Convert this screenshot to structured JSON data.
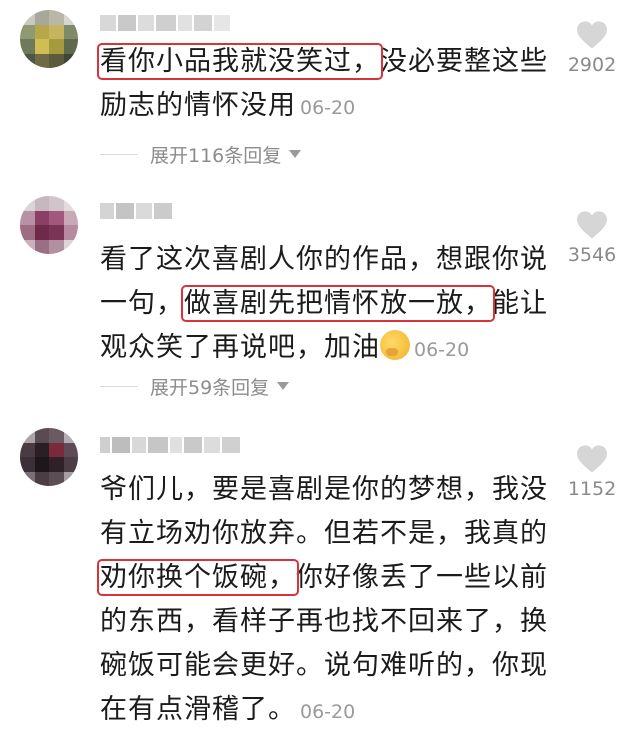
{
  "comments": [
    {
      "text_before": "",
      "highlight": "看你小品我就没笑过，",
      "text_after": "没必要整这些励志的情怀没用",
      "date": "06-20",
      "likes": "2902",
      "replies_label": "展开116条回复",
      "emoji": false
    },
    {
      "text_before": "看了这次喜剧人你的作品，想跟你说一句，",
      "highlight": "做喜剧先把情怀放一放，",
      "text_after": "能让观众笑了再说吧，加油",
      "date": "06-20",
      "likes": "3546",
      "replies_label": "展开59条回复",
      "emoji": true
    },
    {
      "text_before": "爷们儿，要是喜剧是你的梦想，我没有立场劝你放弃。但若不是，我真的",
      "highlight": "劝你换个饭碗，",
      "text_after": "你好像丢了一些以前的东西，看样子再也找不回来了，换碗饭可能会更好。说句难听的，你现在有点滑稽了。",
      "date": "06-20",
      "likes": "1152",
      "replies_label": "",
      "emoji": false
    }
  ],
  "colors": {
    "highlight_box": "#d9333a",
    "text": "#1b1b1b",
    "meta": "#9a9a9a"
  },
  "icons": {
    "like": "heart-icon",
    "expand": "chevron-down-icon",
    "emoji": "thinking-face-emoji"
  }
}
